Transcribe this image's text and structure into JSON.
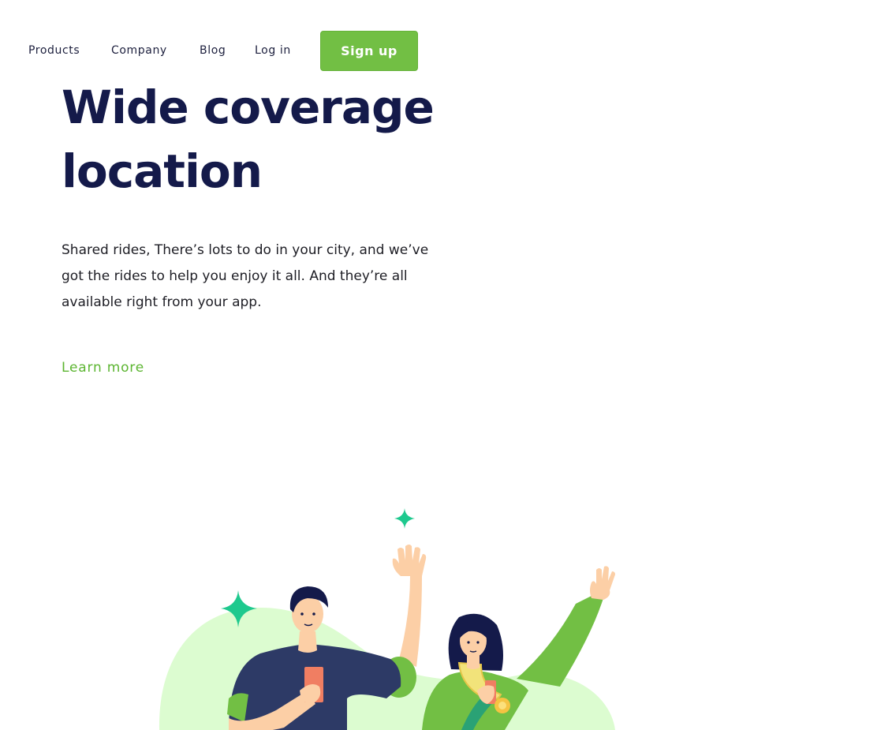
{
  "nav": {
    "products": "Products",
    "company": "Company",
    "blog": "Blog",
    "login": "Log in",
    "signup": "Sign up"
  },
  "hero": {
    "title": "Wide coverage location",
    "body": "Shared rides, There’s lots to do in your city, and we’ve got the rides to help you enjoy it all. And they’re all available right from your app.",
    "cta": "Learn more"
  },
  "colors": {
    "accent": "#72bf44",
    "heading": "#141a4a",
    "link": "#5cb531",
    "blob": "#dcfcd0",
    "sparkle": "#1ec98e"
  },
  "illustration": {
    "icon": "people-waving-illustration"
  }
}
